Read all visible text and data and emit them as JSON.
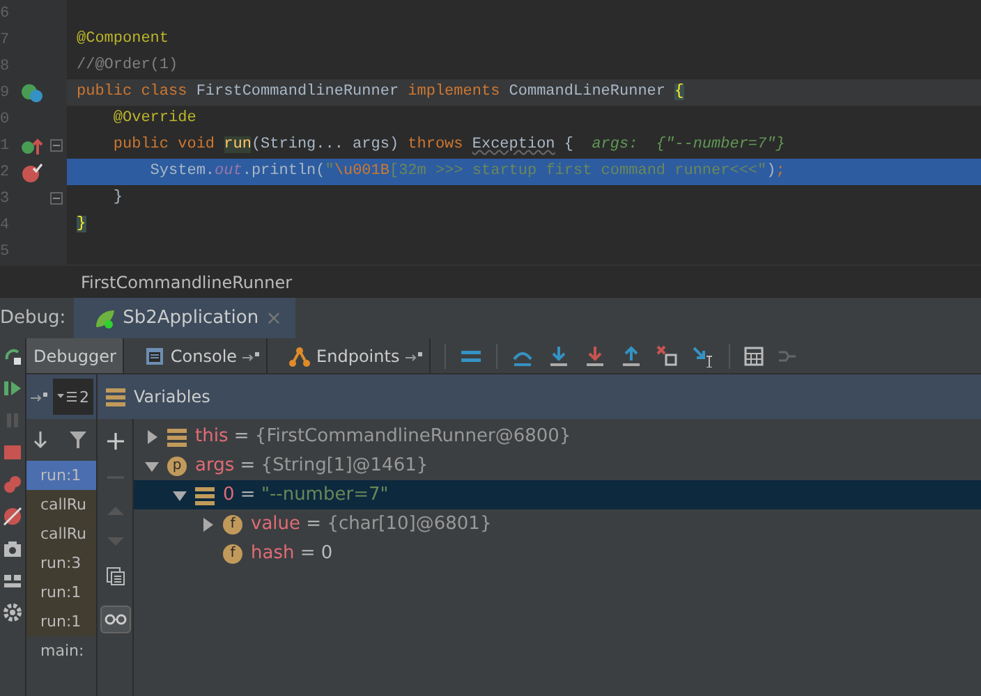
{
  "editor": {
    "lines": [
      {
        "number": "6",
        "kind": "plain",
        "caret": false,
        "current": false
      },
      {
        "number": "7",
        "kind": "plain",
        "caret": false,
        "current": false,
        "tokens": [
          {
            "kind": "annotation",
            "text": "@Component"
          }
        ]
      },
      {
        "number": "8",
        "kind": "plain",
        "caret": false,
        "current": false,
        "tokens": [
          {
            "kind": "comment",
            "text": "//@Order(1)"
          }
        ]
      },
      {
        "number": "9",
        "caret": true,
        "current": false,
        "kind": "class",
        "tokens": [
          {
            "kind": "keyword",
            "text": "public class "
          },
          {
            "kind": "plain",
            "text": "FirstCommandlineRunner "
          },
          {
            "kind": "keyword",
            "text": "implements "
          },
          {
            "kind": "plain",
            "text": "CommandLineRunner "
          },
          {
            "kind": "brace",
            "text": "{"
          }
        ]
      },
      {
        "number": "0",
        "kind": "plain",
        "caret": false,
        "current": false,
        "tokens": [
          {
            "kind": "annotation",
            "text": "    @Override"
          }
        ]
      },
      {
        "number": "1",
        "kind": "override",
        "caret": false,
        "current": false,
        "fold": true,
        "tokens": [
          {
            "kind": "keyword",
            "text": "    public void "
          },
          {
            "kind": "usage",
            "text": "run"
          },
          {
            "kind": "plain",
            "text": "(String... args) "
          },
          {
            "kind": "keyword",
            "text": "throws "
          },
          {
            "kind": "underline",
            "text": "Exception"
          },
          {
            "kind": "plain",
            "text": " {  "
          },
          {
            "kind": "hint",
            "text": "args:  {\"--number=7\"}"
          }
        ]
      },
      {
        "number": "2",
        "caret": false,
        "current": true,
        "kind": "breakpoint",
        "tokens": [
          {
            "kind": "plain",
            "text": "        System."
          },
          {
            "kind": "field",
            "text": "out"
          },
          {
            "kind": "plain",
            "text": ".println("
          },
          {
            "kind": "string",
            "text": "\""
          },
          {
            "kind": "escape",
            "text": "\\u001B"
          },
          {
            "kind": "string",
            "text": "[32m >>> startup first command runner<<<\""
          },
          {
            "kind": "plain",
            "text": ")"
          },
          {
            "kind": "keyword",
            "text": ";"
          }
        ]
      },
      {
        "number": "3",
        "kind": "plain",
        "caret": false,
        "current": false,
        "fold": true,
        "tokens": [
          {
            "kind": "plain",
            "text": "    }"
          }
        ]
      },
      {
        "number": "4",
        "kind": "plain",
        "caret": false,
        "current": false,
        "tokens": [
          {
            "kind": "brace",
            "text": "}"
          }
        ]
      },
      {
        "number": "5",
        "kind": "plain",
        "caret": false,
        "current": false
      }
    ]
  },
  "breadcrumb": "FirstCommandlineRunner",
  "debug": {
    "label": "Debug:",
    "session_tab": "Sb2Application",
    "session_close": "×",
    "tabs": [
      {
        "label": "Debugger",
        "selected": true,
        "kind": "debugger"
      },
      {
        "label": "Console",
        "selected": false,
        "kind": "console"
      },
      {
        "label": "Endpoints",
        "selected": false,
        "kind": "endpoints"
      }
    ],
    "threads_badge": "2",
    "variables_title": "Variables",
    "frames": [
      {
        "text": "run:1",
        "selected": true,
        "library": false
      },
      {
        "text": "callRu",
        "selected": false,
        "library": true
      },
      {
        "text": "callRu",
        "selected": false,
        "library": true
      },
      {
        "text": "run:3",
        "selected": false,
        "library": true
      },
      {
        "text": "run:1",
        "selected": false,
        "library": true
      },
      {
        "text": "run:1",
        "selected": false,
        "library": true
      },
      {
        "text": "main:",
        "selected": false,
        "library": false
      }
    ],
    "variables": [
      {
        "name": "this",
        "operator": "=",
        "value": "{FirstCommandlineRunner@6800}",
        "kind": "object",
        "expanded": false,
        "selected": false
      },
      {
        "name": "args",
        "operator": "=",
        "value": "{String[1]@1461}",
        "kind": "object",
        "badge": "p",
        "expanded": true,
        "selected": false,
        "children": [
          {
            "name": "0",
            "operator": "=",
            "value": "\"--number=7\"",
            "kind": "string",
            "expanded": true,
            "selected": true,
            "children": [
              {
                "name": "value",
                "operator": "=",
                "value": "{char[10]@6801}",
                "kind": "object",
                "badge": "f",
                "expanded": false,
                "selected": false
              },
              {
                "name": "hash",
                "operator": "=",
                "value": "0",
                "kind": "number",
                "badge": "f",
                "leaf": true,
                "selected": false
              }
            ]
          }
        ]
      }
    ]
  }
}
